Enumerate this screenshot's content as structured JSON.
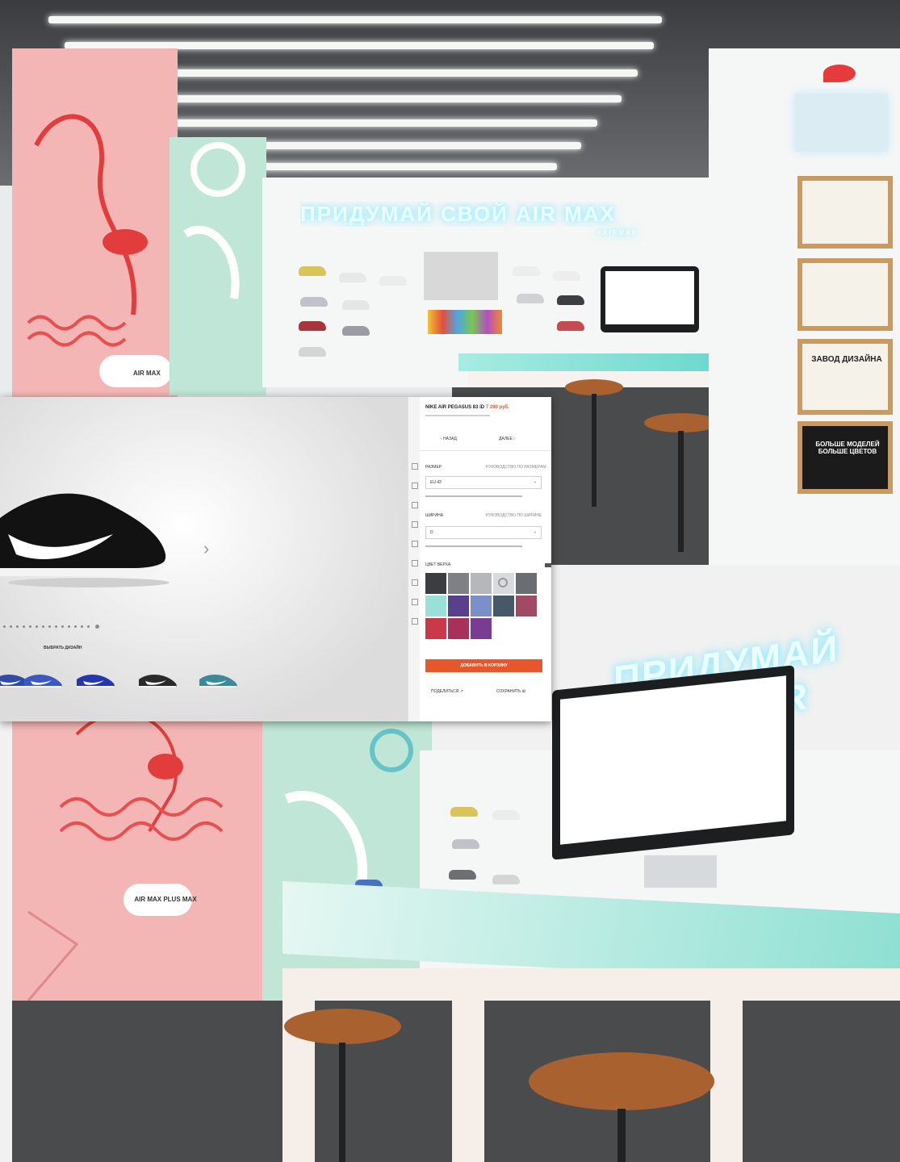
{
  "colors": {
    "accent": "#e8572b",
    "wall_pink": "#f3b6b4",
    "wall_mint": "#bfe6d6",
    "frame_wood": "#c99b62"
  },
  "store_top": {
    "neon_sign": "ПРИДУМАЙ СВОЙ AIR MAX",
    "neon_hashtag": "#AIRMAX",
    "poster_text": "ЗАВОД ДИЗАЙНА",
    "dark_frame_text": "БОЛЬШЕ МОДЕЛЕЙ БОЛЬШЕ ЦВЕТОВ",
    "pedestal_text": "AIR MAX"
  },
  "store_bottom": {
    "pedestal_text": "AIR MAX PLUS MAX"
  },
  "customizer": {
    "product_title": "NIKE AIR PEGASUS 83 iD",
    "price": "7 290 руб.",
    "prev_label": "НАЗАД",
    "next_label": "ДАЛЕЕ",
    "size_label": "РАЗМЕР",
    "size_help": "РУКОВОДСТВО ПО РАЗМЕРАМ",
    "size_value": "EU 42",
    "width_label": "ШИРИНА",
    "width_help": "РУКОВОДСТВО ПО ШИРИНЕ",
    "width_value": "D",
    "colors_label": "ЦВЕТ ВЕРХА",
    "add_to_cart": "ДОБАВИТЬ В КОРЗИНУ",
    "save_label": "СОХРАНИТЬ",
    "share_label": "ПОДЕЛИТЬСЯ",
    "caption": "ВЫБРАТЬ ДИЗАЙН",
    "next_arrow": "›",
    "swatches": [
      "#3c3d40",
      "#7f8085",
      "#b6b7bb",
      "#d9dadd",
      "#ededee",
      "#6a6d72",
      "#98e0d8",
      "#5a3f8c",
      "#7b8fc9",
      "#88b7d6",
      "#455a66",
      "#a04b63",
      "#c9394a",
      "#a8305a",
      "#7a3c92"
    ],
    "thumbnails": [
      "#2f4aa8",
      "#3a57c4",
      "#2436b0",
      "#2a2a2a",
      "#3a8a98"
    ]
  }
}
